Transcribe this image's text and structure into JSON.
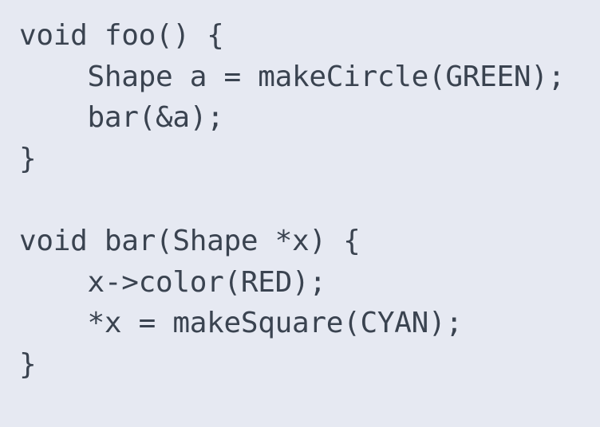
{
  "code": {
    "lines": [
      "void foo() {",
      "    Shape a = makeCircle(GREEN);",
      "    bar(&a);",
      "}",
      "",
      "void bar(Shape *x) {",
      "    x->color(RED);",
      "    *x = makeSquare(CYAN);",
      "}"
    ]
  }
}
